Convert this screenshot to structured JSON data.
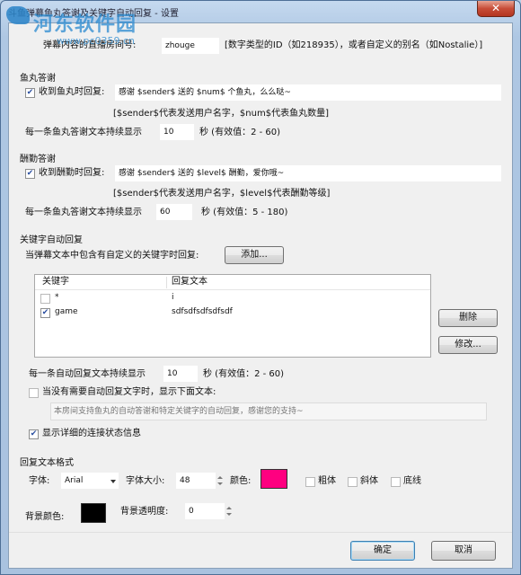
{
  "window": {
    "title": "斗鱼弹幕鱼丸答谢及关键字自动回复 - 设置",
    "close_glyph": "✕"
  },
  "watermark": {
    "text": "河东软件园",
    "url": "www.pc0359.cn"
  },
  "room": {
    "label": "弹幕内容的直播房间号:",
    "value": "zhouge",
    "hint": "[数字类型的ID（如218935），或者自定义的别名（如Nostalie）]"
  },
  "yuwan": {
    "section_title": "鱼丸答谢",
    "checkbox_label": "收到鱼丸时回复:",
    "checked": true,
    "message": "感谢 $sender$ 送的 $num$ 个鱼丸，么么哒~",
    "vars_hint": "[$sender$代表发送用户名字，$num$代表鱼丸数量]",
    "duration_label": "每一条鱼丸答谢文本持续显示",
    "duration_value": "10",
    "duration_unit": "秒 (有效值：2 - 60)"
  },
  "choujin": {
    "section_title": "酬勤答谢",
    "checkbox_label": "收到酬勤时回复:",
    "checked": true,
    "message": "感谢 $sender$ 送的 $level$ 酬勤，爱你哦~",
    "vars_hint": "[$sender$代表发送用户名字，$level$代表酬勤等级]",
    "duration_label": "每一条鱼丸答谢文本持续显示",
    "duration_value": "60",
    "duration_unit": "秒 (有效值：5 - 180)"
  },
  "keyword": {
    "section_title": "关键字自动回复",
    "prompt": "当弹幕文本中包含有自定义的关键字时回复:",
    "add_button": "添加...",
    "columns": [
      "关键字",
      "回复文本"
    ],
    "rows": [
      {
        "keyword": "*",
        "reply": "i",
        "checked": false
      },
      {
        "keyword": "game",
        "reply": "sdfsdfsdfsdfsdf",
        "checked": true
      }
    ],
    "delete_button": "删除",
    "edit_button": "修改...",
    "duration_label": "每一条自动回复文本持续显示",
    "duration_value": "10",
    "duration_unit": "秒 (有效值：2 - 60)",
    "fallback_label": "当没有需要自动回复文字时，显示下面文本:",
    "fallback_checked": false,
    "fallback_text": "本房间支持鱼丸的自动答谢和特定关键字的自动回复，感谢您的支持~",
    "show_status_label": "显示详细的连接状态信息",
    "show_status_checked": true
  },
  "format": {
    "section_title": "回复文本格式",
    "font_label": "字体:",
    "font_value": "Arial",
    "size_label": "字体大小:",
    "size_value": "48",
    "color_label": "颜色:",
    "text_color": "#ff0080",
    "bold_label": "粗体",
    "bold_checked": false,
    "italic_label": "斜体",
    "italic_checked": false,
    "underline_label": "底线",
    "underline_checked": false,
    "bg_color_label": "背景颜色:",
    "bg_color": "#000000",
    "bg_opacity_label": "背景透明度:",
    "bg_opacity_value": "0"
  },
  "footer": {
    "ok_button": "确定",
    "cancel_button": "取消"
  }
}
